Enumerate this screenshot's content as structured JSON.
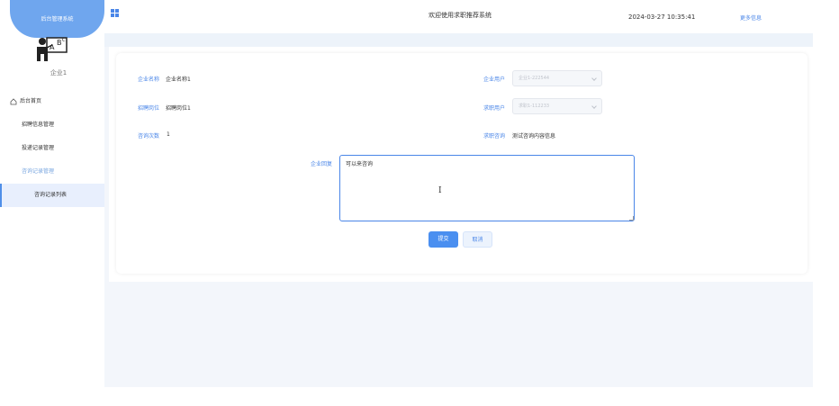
{
  "sidebar": {
    "brand": "后台管理系统",
    "username": "企业1",
    "items": [
      {
        "label": "后台首页"
      },
      {
        "label": "招聘信息管理"
      },
      {
        "label": "投递记录管理"
      },
      {
        "label": "咨询记录管理"
      },
      {
        "label": "咨询记录列表"
      }
    ]
  },
  "topbar": {
    "title": "欢迎使用求职推荐系统",
    "datetime": "2024-03-27 10:35:41",
    "more": "更多信息"
  },
  "form": {
    "company_name": {
      "label": "企业名称",
      "value": "企业名称1"
    },
    "company_user": {
      "label": "企业用户",
      "placeholder": "企业1-222544"
    },
    "position": {
      "label": "招聘岗位",
      "value": "招聘岗位1"
    },
    "job_seeker": {
      "label": "求职用户",
      "placeholder": "求职1-112233"
    },
    "consult_count": {
      "label": "咨询次数",
      "value": "1"
    },
    "consult_content": {
      "label": "求职咨询",
      "value": "测试咨询内容信息"
    },
    "reply": {
      "label": "企业回复",
      "value": "可以来咨询"
    },
    "submit_label": "提交",
    "cancel_label": "取消"
  },
  "colors": {
    "accent": "#4a86e8",
    "brand": "#6fa6ee"
  }
}
